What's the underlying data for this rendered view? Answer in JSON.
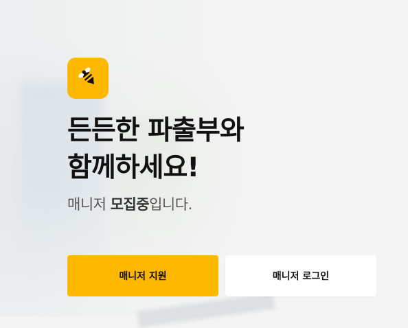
{
  "brand": {
    "logo_icon": "bee-icon",
    "accent_color": "#FFB800"
  },
  "hero": {
    "headline_line1": "든든한 파출부와",
    "headline_line2": "함께하세요!",
    "sub_prefix": "매니저 ",
    "sub_emphasis": "모집중",
    "sub_suffix": "입니다."
  },
  "actions": {
    "apply_label": "매니저 지원",
    "login_label": "매니저 로그인"
  }
}
